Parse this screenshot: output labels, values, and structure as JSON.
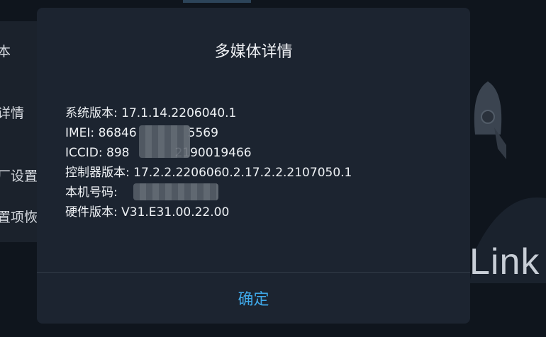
{
  "background": {
    "menu_items": [
      "本",
      "详情",
      "厂设置",
      "置项恢"
    ],
    "brand_text": "Link"
  },
  "dialog": {
    "title": "多媒体详情",
    "rows": [
      {
        "label": "系统版本:",
        "value": "17.1.14.2206040.1"
      },
      {
        "label": "IMEI:",
        "value": "86846",
        "suffix": "5569"
      },
      {
        "label": "ICCID:",
        "value": "898",
        "suffix": "2190019466"
      },
      {
        "label": "控制器版本:",
        "value": "17.2.2.2206060.2.17.2.2.2107050.1"
      },
      {
        "label": "本机号码:",
        "value": ""
      },
      {
        "label": "硬件版本:",
        "value": "V31.E31.00.22.00"
      }
    ],
    "confirm_label": "确定"
  },
  "colors": {
    "accent": "#3fa8e8",
    "dialog_bg": "#1c2430",
    "page_bg": "#0f151d"
  }
}
